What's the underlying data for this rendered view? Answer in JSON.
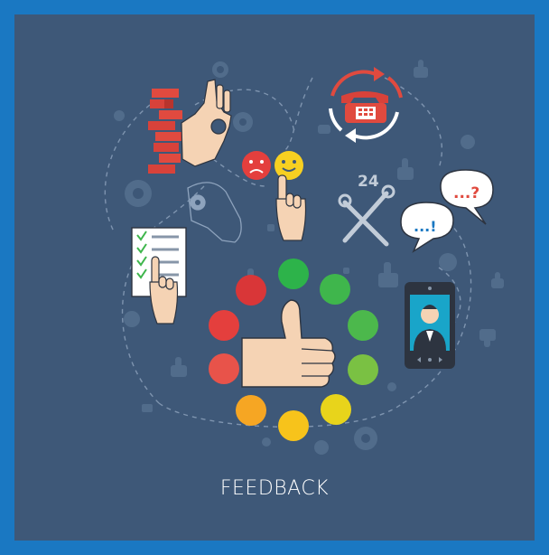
{
  "caption": "FEEDBACK",
  "badge_24": "24",
  "speech_small_text": "...!",
  "speech_large_text": "...?",
  "colors": {
    "frame": "#1a78c2",
    "background": "#3e5878",
    "skin": "#f5d3b4",
    "phone_body": "#2d3440",
    "phone_screen": "#19a5c9",
    "rating_dots": [
      "#2db34a",
      "#3fb64c",
      "#4cb84c",
      "#7ac143",
      "#e8d41b",
      "#f7c31b",
      "#f6a623",
      "#e8534a",
      "#e43f3d",
      "#d93638"
    ]
  },
  "icons": [
    "ok-gesture-hand-icon",
    "brick-wall-icon",
    "telephone-icon",
    "refresh-arrows-icon",
    "sad-face-icon",
    "happy-face-icon",
    "pointing-hand-icon",
    "tools-24-icon",
    "speech-bubbles-icon",
    "checklist-icon",
    "smartphone-user-icon",
    "thumbs-up-icon",
    "gear-icon"
  ]
}
